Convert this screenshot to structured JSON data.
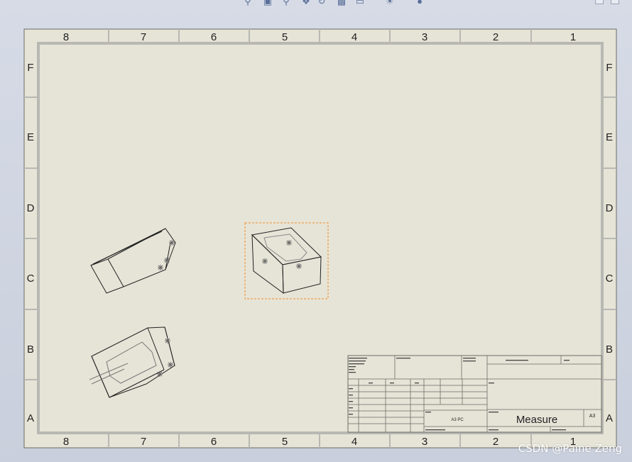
{
  "toolbar": {
    "icons": [
      "zoom-icon",
      "zoom-area-icon",
      "zoom-prev-icon",
      "pan-icon",
      "rotate-icon",
      "display-style-icon",
      "view-orient-icon",
      "light-icon",
      "appearance-icon"
    ]
  },
  "sheet": {
    "columns": [
      "8",
      "7",
      "6",
      "5",
      "4",
      "3",
      "2",
      "1"
    ],
    "rows": [
      "F",
      "E",
      "D",
      "C",
      "B",
      "A"
    ]
  },
  "title_block": {
    "drawing_title": "Measure",
    "sheet_size": "A3",
    "sheet_format": "A3 PC"
  },
  "watermark": "CSDN @Paine Zeng",
  "colors": {
    "sheet_bg": "#e6e4d7",
    "border": "#b5b5b0",
    "selection": "#f28c28"
  }
}
